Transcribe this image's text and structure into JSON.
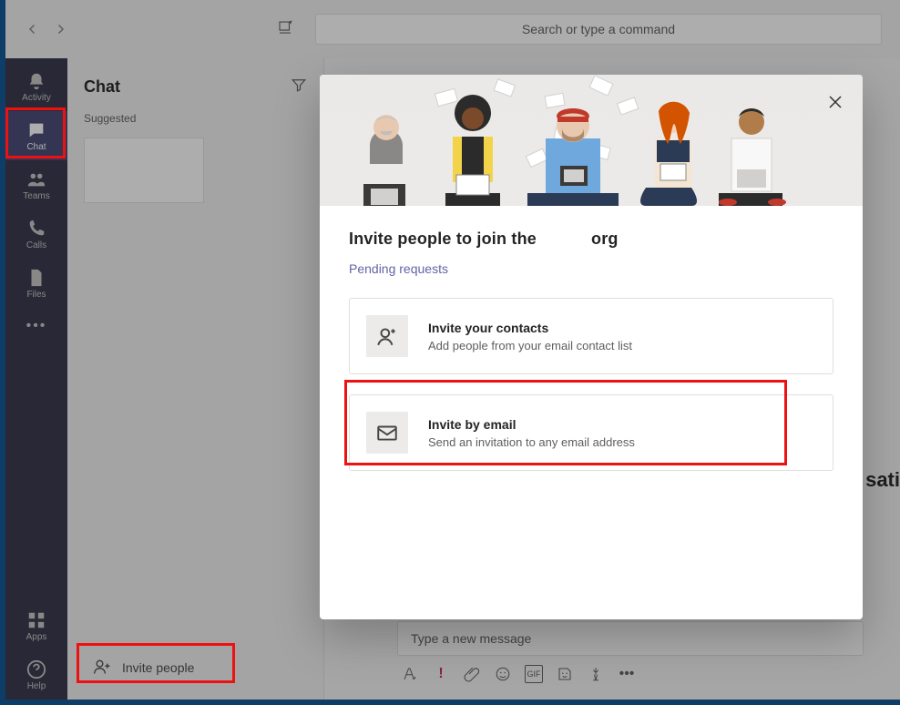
{
  "topbar": {
    "search_placeholder": "Search or type a command"
  },
  "rail": {
    "activity": "Activity",
    "chat": "Chat",
    "teams": "Teams",
    "calls": "Calls",
    "files": "Files",
    "apps": "Apps",
    "help": "Help"
  },
  "chat_panel": {
    "title": "Chat",
    "suggested_label": "Suggested",
    "invite_button": "Invite people"
  },
  "compose": {
    "placeholder": "Type a new message",
    "gif_label": "GIF"
  },
  "modal": {
    "title_prefix": "Invite people to join the",
    "title_suffix": "org",
    "pending_link": "Pending requests",
    "card_contacts_title": "Invite your contacts",
    "card_contacts_sub": "Add people from your email contact list",
    "card_email_title": "Invite by email",
    "card_email_sub": "Send an invitation to any email address"
  },
  "cutoff_text": "sati"
}
